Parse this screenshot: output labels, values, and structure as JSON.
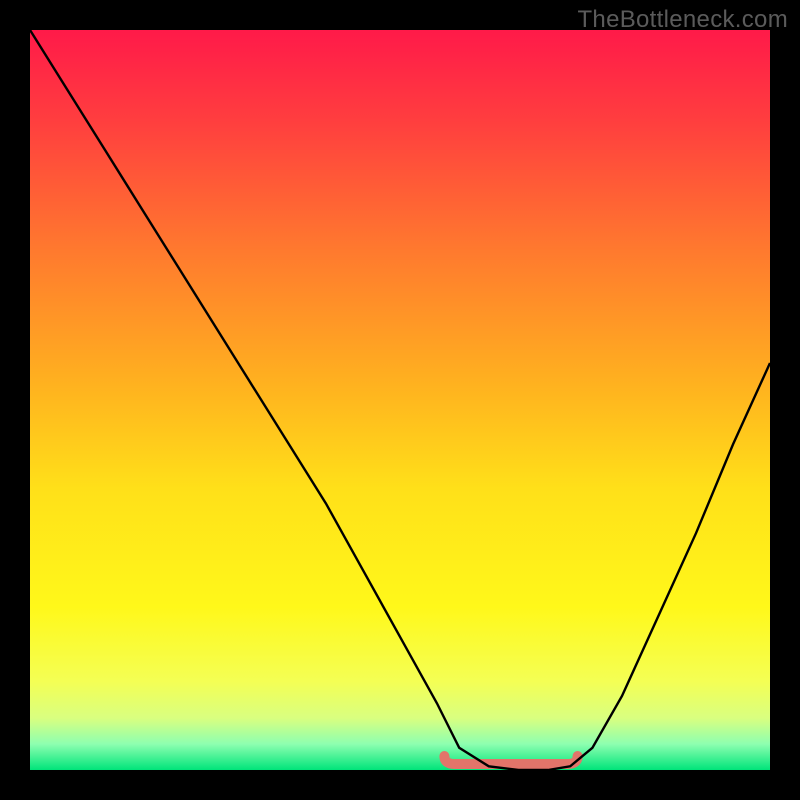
{
  "watermark": "TheBottleneck.com",
  "colors": {
    "gradient_stops": [
      {
        "offset": 0.0,
        "color": "#ff1a49"
      },
      {
        "offset": 0.12,
        "color": "#ff3d3f"
      },
      {
        "offset": 0.3,
        "color": "#ff7a2e"
      },
      {
        "offset": 0.48,
        "color": "#ffb21f"
      },
      {
        "offset": 0.62,
        "color": "#ffe019"
      },
      {
        "offset": 0.78,
        "color": "#fff81a"
      },
      {
        "offset": 0.88,
        "color": "#f4ff54"
      },
      {
        "offset": 0.93,
        "color": "#d9ff80"
      },
      {
        "offset": 0.965,
        "color": "#8dffb0"
      },
      {
        "offset": 1.0,
        "color": "#00e47a"
      }
    ],
    "marker": "#e2746a",
    "curve": "#000000",
    "frame": "#000000"
  },
  "chart_data": {
    "type": "line",
    "title": "",
    "xlabel": "",
    "ylabel": "",
    "xlim": [
      0,
      100
    ],
    "ylim": [
      0,
      100
    ],
    "x": [
      0,
      5,
      10,
      15,
      20,
      25,
      30,
      35,
      40,
      45,
      50,
      55,
      58,
      62,
      66,
      70,
      73,
      76,
      80,
      85,
      90,
      95,
      100
    ],
    "values": [
      100,
      92,
      84,
      76,
      68,
      60,
      52,
      44,
      36,
      27,
      18,
      9,
      3,
      0.5,
      0,
      0,
      0.5,
      3,
      10,
      21,
      32,
      44,
      55
    ],
    "marker_segment": {
      "x_start": 56,
      "x_end": 74,
      "y": 0
    }
  }
}
